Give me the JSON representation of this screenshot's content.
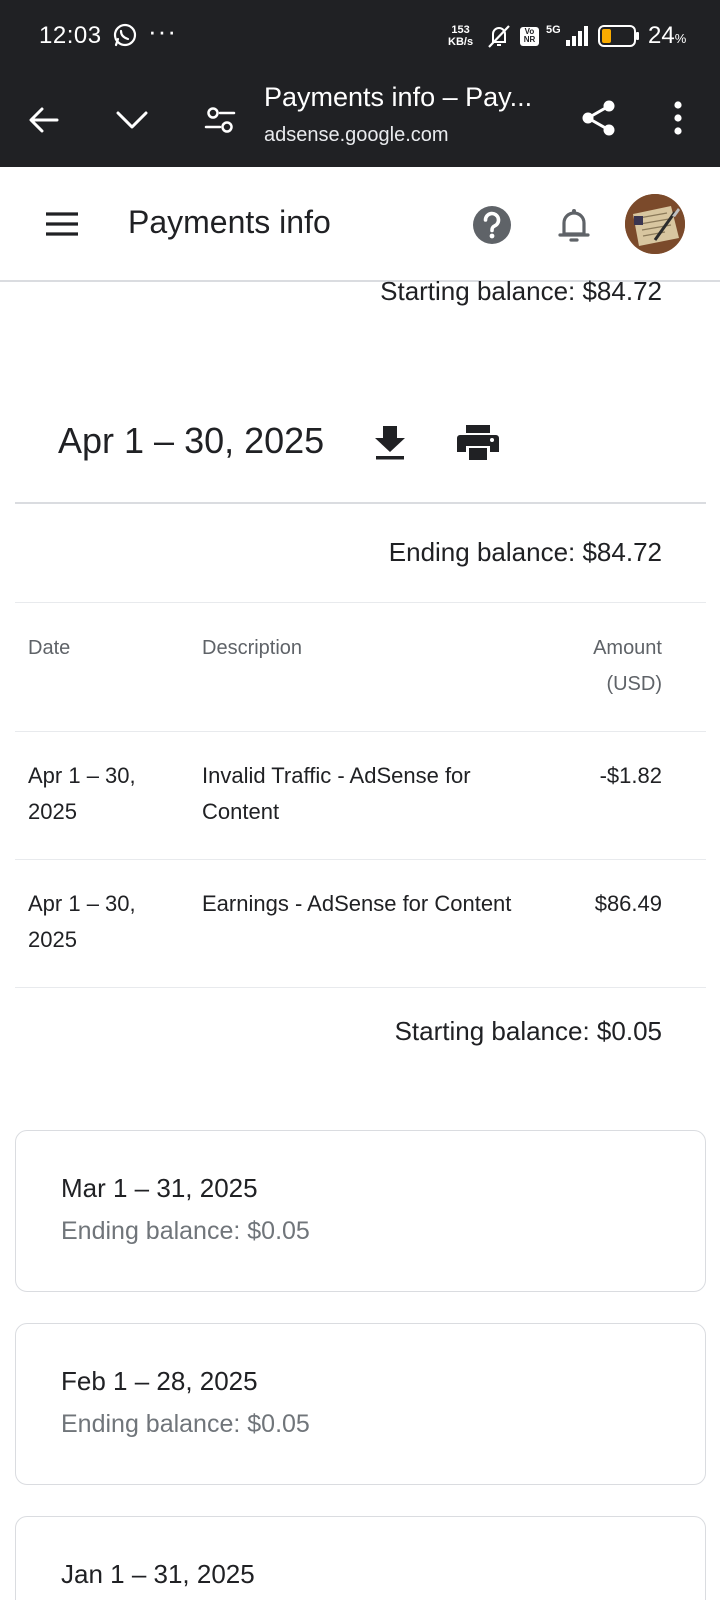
{
  "status_bar": {
    "time": "12:03",
    "more": "···",
    "speed_value": "153",
    "speed_unit": "KB/s",
    "volte_top": "Vo",
    "volte_bottom": "NR",
    "network": "5G",
    "battery_percent": "24",
    "battery_unit": "%"
  },
  "browser": {
    "title": "Payments info – Pay...",
    "url": "adsense.google.com"
  },
  "header": {
    "title": "Payments info"
  },
  "top_starting_balance": "Starting balance: $84.72",
  "current_period": {
    "title": "Apr 1 – 30, 2025",
    "ending_balance": "Ending balance: $84.72",
    "columns": {
      "date": "Date",
      "description": "Description",
      "amount": "Amount (USD)"
    },
    "rows": [
      {
        "date": "Apr 1 – 30, 2025",
        "description": "Invalid Traffic - AdSense for Content",
        "amount": "-$1.82"
      },
      {
        "date": "Apr 1 – 30, 2025",
        "description": "Earnings - AdSense for Content",
        "amount": "$86.49"
      }
    ],
    "starting_balance": "Starting balance: $0.05"
  },
  "previous_periods": [
    {
      "title": "Mar 1 – 31, 2025",
      "ending_balance": "Ending balance: $0.05"
    },
    {
      "title": "Feb 1 – 28, 2025",
      "ending_balance": "Ending balance: $0.05"
    },
    {
      "title": "Jan 1 – 31, 2025",
      "ending_balance": ""
    }
  ],
  "colors": {
    "chrome_bg": "#202124",
    "text_primary": "#202124",
    "text_secondary": "#5f6368",
    "divider": "#dadce0",
    "battery_fill": "#f9ab00"
  },
  "icons": [
    "whatsapp-icon",
    "mute-icon",
    "signal-icon",
    "battery-icon",
    "back-icon",
    "chevron-down-icon",
    "tune-icon",
    "share-icon",
    "more-vert-icon",
    "menu-icon",
    "help-icon",
    "bell-icon",
    "avatar",
    "download-icon",
    "print-icon"
  ]
}
